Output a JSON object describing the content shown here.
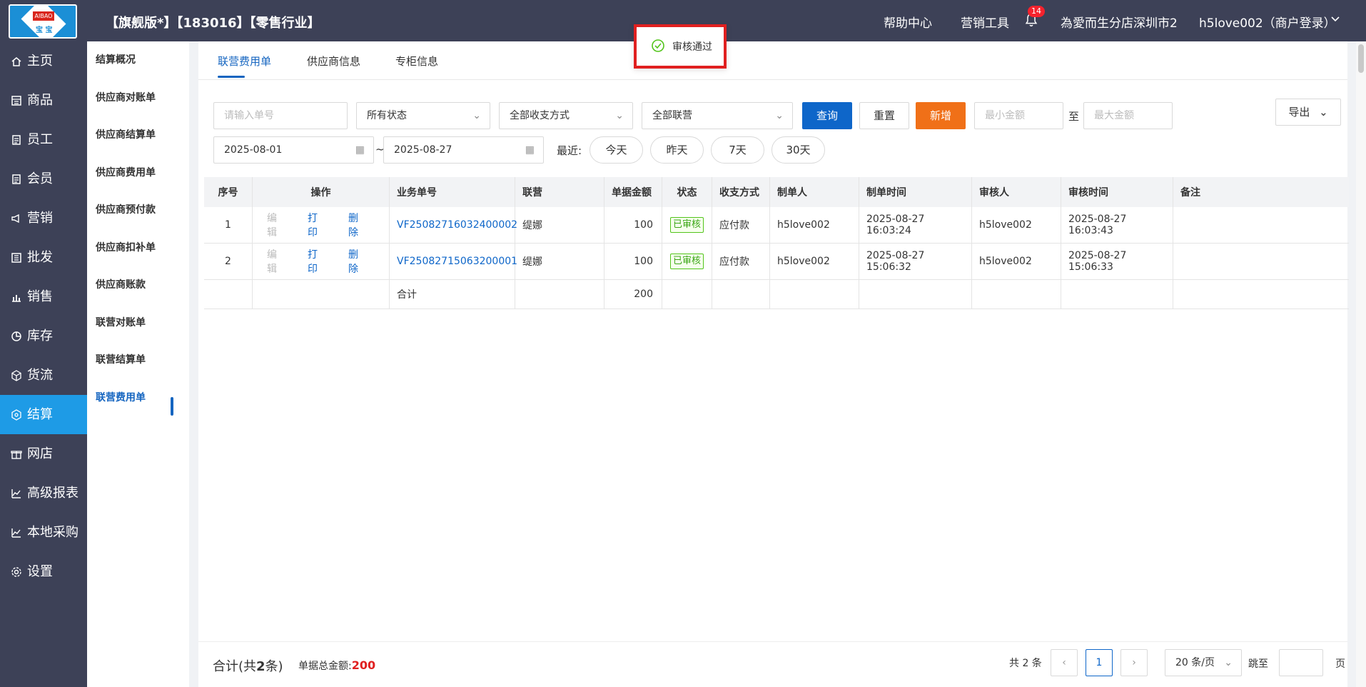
{
  "header": {
    "logo_top": "AIBAO",
    "logo_bottom": "宝 宝",
    "system_title": "【旗舰版*】【183016】【零售行业】",
    "help": "帮助中心",
    "marketing_tools": "营销工具",
    "notification_count": "14",
    "store": "為愛而生分店深圳市2",
    "user": "h5love002（商户登录）"
  },
  "sidebar": {
    "items": [
      {
        "label": "主页",
        "icon": "home-icon"
      },
      {
        "label": "商品",
        "icon": "goods-icon"
      },
      {
        "label": "员工",
        "icon": "staff-icon"
      },
      {
        "label": "会员",
        "icon": "member-icon"
      },
      {
        "label": "营销",
        "icon": "megaphone-icon"
      },
      {
        "label": "批发",
        "icon": "wholesale-icon"
      },
      {
        "label": "销售",
        "icon": "sales-chart-icon"
      },
      {
        "label": "库存",
        "icon": "pie-icon"
      },
      {
        "label": "货流",
        "icon": "cube-icon"
      },
      {
        "label": "结算",
        "icon": "settle-icon"
      },
      {
        "label": "网店",
        "icon": "gift-icon"
      },
      {
        "label": "高级报表",
        "icon": "line-chart-icon"
      },
      {
        "label": "本地采购",
        "icon": "trend-icon"
      },
      {
        "label": "设置",
        "icon": "gear-icon"
      }
    ]
  },
  "subnav": {
    "items": [
      "结算概况",
      "供应商对账单",
      "供应商结算单",
      "供应商费用单",
      "供应商预付款",
      "供应商扣补单",
      "供应商账款",
      "联营对账单",
      "联营结算单",
      "联营费用单"
    ]
  },
  "tabs": [
    "联营费用单",
    "供应商信息",
    "专柜信息"
  ],
  "toast": {
    "message": "审核通过"
  },
  "filters": {
    "order_placeholder": "请输入单号",
    "status": "所有状态",
    "payment_method": "全部收支方式",
    "joint": "全部联营",
    "query": "查询",
    "reset": "重置",
    "add": "新增",
    "min_placeholder": "最小金额",
    "to": "至",
    "max_placeholder": "最大金额",
    "export": "导出",
    "date_start": "2025-08-01",
    "date_sep": "~",
    "date_end": "2025-08-27",
    "recent_label": "最近:",
    "recent": [
      "今天",
      "昨天",
      "7天",
      "30天"
    ]
  },
  "table": {
    "headers": [
      "序号",
      "操作",
      "业务单号",
      "联营",
      "单据金额",
      "状态",
      "收支方式",
      "制单人",
      "制单时间",
      "审核人",
      "审核时间",
      "备注"
    ],
    "actions": {
      "edit": "编辑",
      "print": "打印",
      "delete": "删除"
    },
    "rows": [
      {
        "no": "1",
        "order": "VF25082716032400002",
        "joint": "缇娜",
        "amount": "100",
        "status": "已审核",
        "payment": "应付款",
        "creator": "h5love002",
        "created": "2025-08-27 16:03:24",
        "auditor": "h5love002",
        "audited": "2025-08-27 16:03:43",
        "note": ""
      },
      {
        "no": "2",
        "order": "VF25082715063200001",
        "joint": "缇娜",
        "amount": "100",
        "status": "已审核",
        "payment": "应付款",
        "creator": "h5love002",
        "created": "2025-08-27 15:06:32",
        "auditor": "h5love002",
        "audited": "2025-08-27 15:06:33",
        "note": ""
      }
    ],
    "total_label": "合计",
    "total_amount": "200"
  },
  "footer": {
    "summary_prefix": "合计(共",
    "summary_count": "2",
    "summary_suffix": "条)",
    "amount_label": "单据总金额:",
    "amount_value": "200",
    "total_items": "共 2 条",
    "current_page": "1",
    "page_size": "20 条/页",
    "jump_label": "跳至",
    "page_unit": "页"
  },
  "colors": {
    "primary": "#0e66c9",
    "active_nav": "#1e9be6",
    "topbar": "#3d4157",
    "add_button": "#f07018",
    "total_amount": "#e02020"
  }
}
